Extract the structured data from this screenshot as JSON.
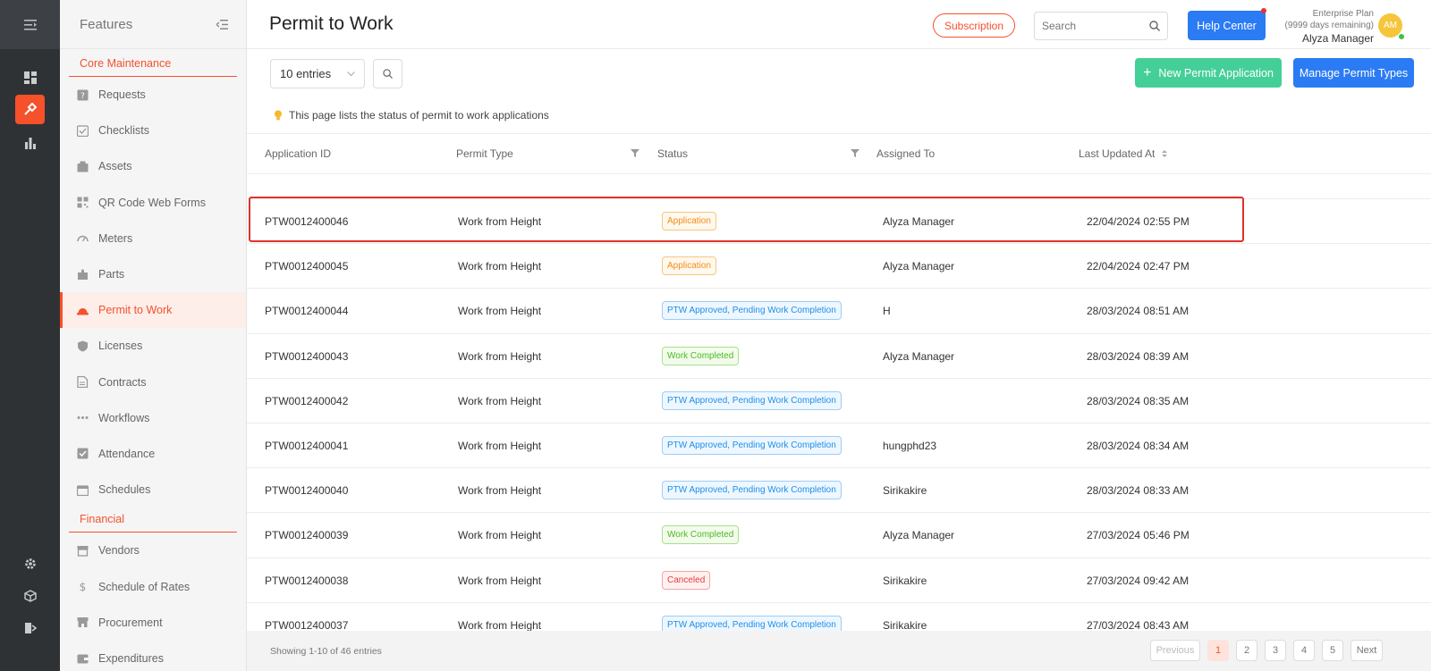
{
  "sidebar": {
    "title": "Features",
    "sections": [
      {
        "label": "Core Maintenance"
      },
      {
        "label": "Financial"
      }
    ],
    "core_items": [
      {
        "label": "Requests",
        "icon": "question-icon"
      },
      {
        "label": "Checklists",
        "icon": "checklist-icon"
      },
      {
        "label": "Assets",
        "icon": "asset-icon"
      },
      {
        "label": "QR Code Web Forms",
        "icon": "qr-code-icon"
      },
      {
        "label": "Meters",
        "icon": "gauge-icon"
      },
      {
        "label": "Parts",
        "icon": "puzzle-icon"
      },
      {
        "label": "Permit to Work",
        "icon": "helmet-icon"
      },
      {
        "label": "Licenses",
        "icon": "shield-icon"
      },
      {
        "label": "Contracts",
        "icon": "contract-icon"
      },
      {
        "label": "Workflows",
        "icon": "dots-icon"
      },
      {
        "label": "Attendance",
        "icon": "check-square-icon"
      },
      {
        "label": "Schedules",
        "icon": "calendar-icon"
      }
    ],
    "financial_items": [
      {
        "label": "Vendors",
        "icon": "store-icon"
      },
      {
        "label": "Schedule of Rates",
        "icon": "dollar-icon"
      },
      {
        "label": "Procurement",
        "icon": "cart-icon"
      },
      {
        "label": "Expenditures",
        "icon": "wallet-icon"
      }
    ],
    "active_item": "Permit to Work"
  },
  "header": {
    "title": "Permit to Work",
    "subscription_label": "Subscription",
    "search_placeholder": "Search",
    "help_label": "Help Center",
    "plan": "Enterprise Plan",
    "days_remaining": "(9999 days remaining)",
    "user_name": "Alyza Manager",
    "avatar_initials": "AM"
  },
  "toolbar": {
    "entries_label": "10 entries",
    "new_label": "New Permit Application",
    "manage_label": "Manage Permit Types"
  },
  "hint": "This page lists the status of permit to work applications",
  "table": {
    "columns": [
      "Application ID",
      "Permit Type",
      "Status",
      "Assigned To",
      "Last Updated At"
    ],
    "rows": [
      {
        "id": "PTW0012400046",
        "type": "Work from Height",
        "status": "Application",
        "status_kind": "application",
        "assigned": "Alyza Manager",
        "updated": "22/04/2024 02:55 PM"
      },
      {
        "id": "PTW0012400045",
        "type": "Work from Height",
        "status": "Application",
        "status_kind": "application",
        "assigned": "Alyza Manager",
        "updated": "22/04/2024 02:47 PM"
      },
      {
        "id": "PTW0012400044",
        "type": "Work from Height",
        "status": "PTW Approved, Pending Work Completion",
        "status_kind": "ptw",
        "assigned": "H",
        "updated": "28/03/2024 08:51 AM"
      },
      {
        "id": "PTW0012400043",
        "type": "Work from Height",
        "status": "Work Completed",
        "status_kind": "completed",
        "assigned": "Alyza Manager",
        "updated": "28/03/2024 08:39 AM"
      },
      {
        "id": "PTW0012400042",
        "type": "Work from Height",
        "status": "PTW Approved, Pending Work Completion",
        "status_kind": "ptw",
        "assigned": "",
        "updated": "28/03/2024 08:35 AM"
      },
      {
        "id": "PTW0012400041",
        "type": "Work from Height",
        "status": "PTW Approved, Pending Work Completion",
        "status_kind": "ptw",
        "assigned": "hungphd23",
        "updated": "28/03/2024 08:34 AM"
      },
      {
        "id": "PTW0012400040",
        "type": "Work from Height",
        "status": "PTW Approved, Pending Work Completion",
        "status_kind": "ptw",
        "assigned": "Sirikakire",
        "updated": "28/03/2024 08:33 AM"
      },
      {
        "id": "PTW0012400039",
        "type": "Work from Height",
        "status": "Work Completed",
        "status_kind": "completed",
        "assigned": "Alyza Manager",
        "updated": "27/03/2024 05:46 PM"
      },
      {
        "id": "PTW0012400038",
        "type": "Work from Height",
        "status": "Canceled",
        "status_kind": "canceled",
        "assigned": "Sirikakire",
        "updated": "27/03/2024 09:42 AM"
      },
      {
        "id": "PTW0012400037",
        "type": "Work from Height",
        "status": "PTW Approved, Pending Work Completion",
        "status_kind": "ptw",
        "assigned": "Sirikakire",
        "updated": "27/03/2024 08:43 AM"
      }
    ]
  },
  "footer": {
    "showing": "Showing 1-10 of 46 entries",
    "previous": "Previous",
    "pages": [
      "1",
      "2",
      "3",
      "4",
      "5"
    ],
    "current_page": "1",
    "next": "Next"
  },
  "colors": {
    "accent": "#f5512b",
    "primary": "#2b7bf4",
    "success_button": "#45cf98",
    "rail": "#2f3235"
  }
}
